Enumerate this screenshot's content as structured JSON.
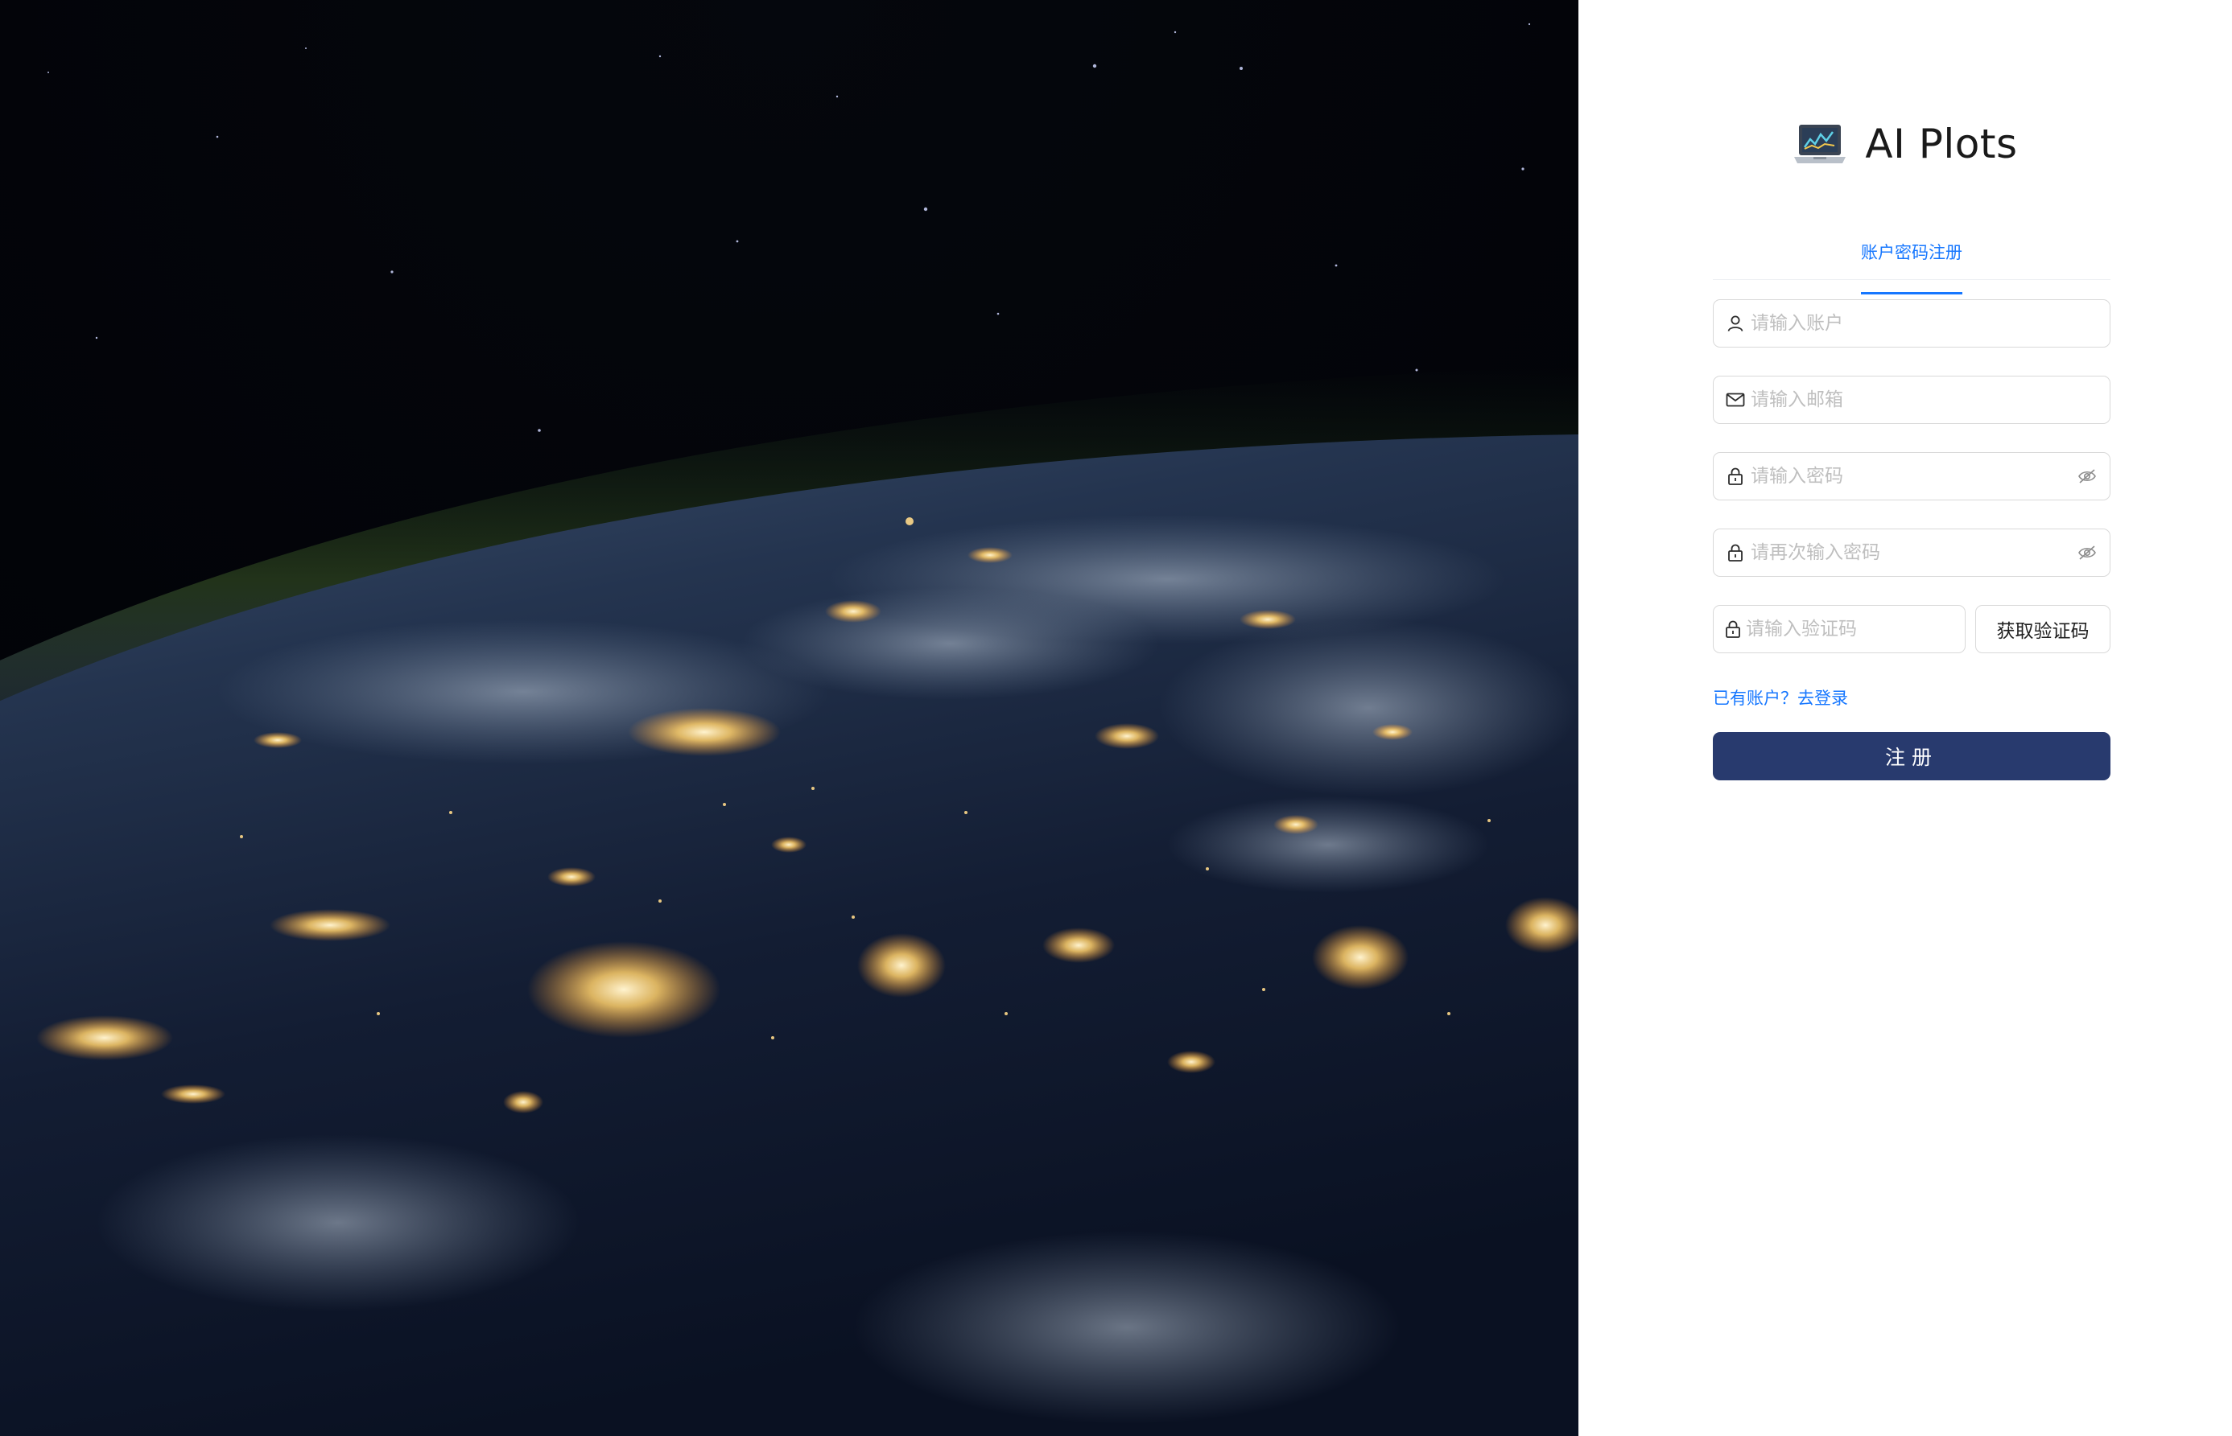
{
  "brand": {
    "name": "AI Plots",
    "logo_icon": "laptop-chart-icon"
  },
  "tabs": [
    {
      "label": "账户密码注册",
      "active": true
    }
  ],
  "form": {
    "account_placeholder": "请输入账户",
    "email_placeholder": "请输入邮箱",
    "password_placeholder": "请输入密码",
    "confirm_placeholder": "请再次输入密码",
    "code_placeholder": "请输入验证码",
    "get_code_label": "获取验证码",
    "login_link": "已有账户？去登录",
    "submit_label": "注册"
  },
  "icons": {
    "account": "user-icon",
    "email": "mail-icon",
    "password": "lock-icon",
    "toggle_visibility": "eye-invisible-icon"
  },
  "colors": {
    "accent": "#1677ff",
    "primary_button": "#283a6e",
    "border": "#d9d9d9",
    "placeholder": "#bfbfbf"
  }
}
